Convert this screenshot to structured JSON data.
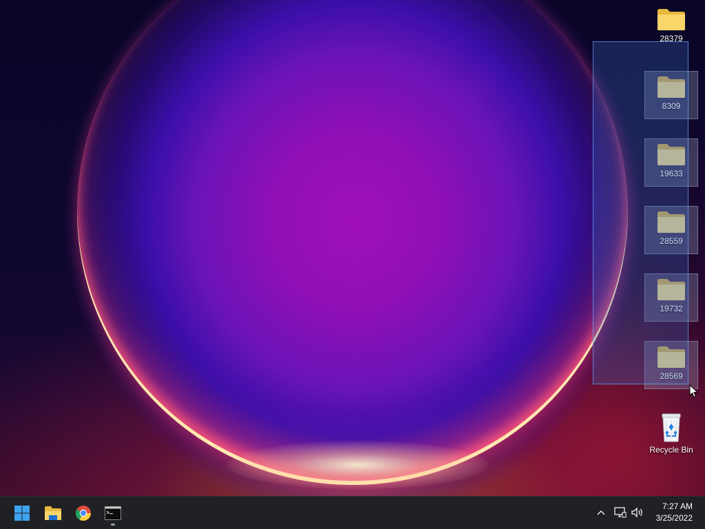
{
  "desktop": {
    "icons": [
      {
        "label": "28379",
        "icon": "folder-icon",
        "selected": false
      },
      {
        "label": "8309",
        "icon": "folder-icon",
        "selected": true
      },
      {
        "label": "19633",
        "icon": "folder-icon",
        "selected": true
      },
      {
        "label": "28559",
        "icon": "folder-icon",
        "selected": true
      },
      {
        "label": "19732",
        "icon": "folder-icon",
        "selected": true
      },
      {
        "label": "28569",
        "icon": "folder-icon",
        "selected": true
      },
      {
        "label": "Recycle Bin",
        "icon": "recycle-bin-icon",
        "selected": false
      }
    ]
  },
  "taskbar": {
    "pinned": [
      {
        "name": "start",
        "icon": "windows-logo-icon"
      },
      {
        "name": "file-explorer",
        "icon": "file-explorer-icon"
      },
      {
        "name": "chrome",
        "icon": "chrome-icon"
      },
      {
        "name": "command-prompt",
        "icon": "terminal-icon",
        "running": true
      }
    ],
    "tray": {
      "icons": [
        "chevron-up-icon",
        "network-icon",
        "volume-icon"
      ]
    },
    "clock": {
      "time": "7:27 AM",
      "date": "3/25/2022"
    }
  },
  "colors": {
    "taskbar_bg": "#202124",
    "folder_yellow": "#f7d46b",
    "selection_blue": "#3c6ec8"
  }
}
